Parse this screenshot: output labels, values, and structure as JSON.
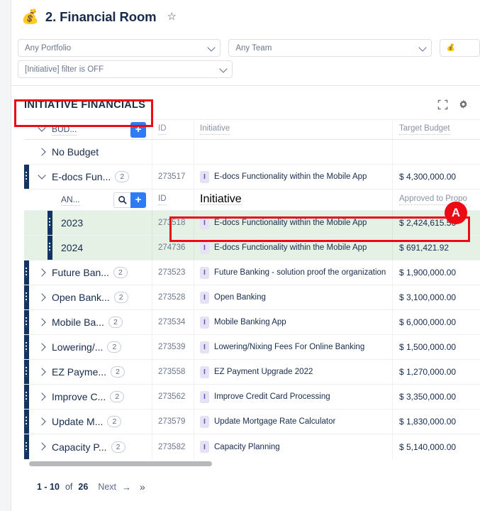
{
  "header": {
    "emoji": "💰",
    "title": "2. Financial Room",
    "star_icon": "★",
    "favorite_label": "☆"
  },
  "filters": [
    {
      "name": "portfolio",
      "value": "Any Portfolio",
      "caret": "chevron-down-icon"
    },
    {
      "name": "team",
      "value": "Any Team",
      "caret": "chevron-down-icon"
    },
    {
      "name": "initiative",
      "value": "[Initiative] filter is OFF",
      "caret": "chevron-down-icon"
    },
    {
      "name": "overflow",
      "value": "💰",
      "caret": ""
    }
  ],
  "card": {
    "title": "INITIATIVE FINANCIALS",
    "expand_icon": "fullscreen-icon",
    "settings_icon": "gear-icon"
  },
  "grid": {
    "header": {
      "group_label": "BUD...",
      "id_label": "ID",
      "initiative_label": "Initiative",
      "amount_label": "Target Budget",
      "add_label": "+"
    },
    "nested_header": {
      "group_label": "AN...",
      "id_label": "ID",
      "initiative_label": "Initiative",
      "amount_label": "Approved to Propo",
      "add_label": "+",
      "search_label": "search-icon"
    },
    "rows": [
      {
        "group": "No Budget",
        "count": "",
        "id": "",
        "initiative": "",
        "amount": "",
        "expanded": false,
        "empty": true
      },
      {
        "group": "E-docs Fun...",
        "count": "2",
        "id": "273517",
        "initiative": "E-docs Functionality within the Mobile App",
        "amount": "$ 4,300,000.00",
        "expanded": true
      },
      {
        "group": "Future Ban...",
        "count": "2",
        "id": "273523",
        "initiative": "Future Banking - solution proof the organization",
        "amount": "$ 1,900,000.00",
        "expanded": false
      },
      {
        "group": "Open Bank...",
        "count": "2",
        "id": "273528",
        "initiative": "Open Banking",
        "amount": "$ 3,100,000.00",
        "expanded": false
      },
      {
        "group": "Mobile Ba...",
        "count": "2",
        "id": "273534",
        "initiative": "Mobile Banking App",
        "amount": "$ 6,000,000.00",
        "expanded": false
      },
      {
        "group": "Lowering/...",
        "count": "2",
        "id": "273539",
        "initiative": "Lowering/Nixing Fees For Online Banking",
        "amount": "$ 1,500,000.00",
        "expanded": false
      },
      {
        "group": "EZ Payme...",
        "count": "2",
        "id": "273558",
        "initiative": "EZ Payment Upgrade 2022",
        "amount": "$ 1,270,000.00",
        "expanded": false
      },
      {
        "group": "Improve C...",
        "count": "2",
        "id": "273562",
        "initiative": "Improve Credit Card Processing",
        "amount": "$ 3,350,000.00",
        "expanded": false
      },
      {
        "group": "Update M...",
        "count": "2",
        "id": "273579",
        "initiative": "Update Mortgage Rate Calculator",
        "amount": "$ 1,830,000.00",
        "expanded": false
      },
      {
        "group": "Capacity P...",
        "count": "2",
        "id": "273582",
        "initiative": "Capacity Planning",
        "amount": "$ 5,140,000.00",
        "expanded": false
      }
    ],
    "nested_rows": [
      {
        "year": "2023",
        "id": "273518",
        "initiative": "E-docs Functionality within the Mobile App",
        "amount": "$ 2,424,615.56"
      },
      {
        "year": "2024",
        "id": "274736",
        "initiative": "E-docs Functionality within the Mobile App",
        "amount": "$ 691,421.92"
      }
    ],
    "initiative_badge": "I"
  },
  "pagination": {
    "range": "1 - 10",
    "of": "of",
    "total": "26",
    "next": "Next",
    "next_arrow": "→",
    "last_arrow": "»"
  },
  "annotations": [
    {
      "id": "A",
      "label": "A"
    }
  ],
  "colors": {
    "accent_blue": "#2f7bf6",
    "rail_navy": "#123463",
    "row_green": "#e5f1e5",
    "annotation_red": "#ec0a14",
    "badge_purple": "#6554c0"
  }
}
